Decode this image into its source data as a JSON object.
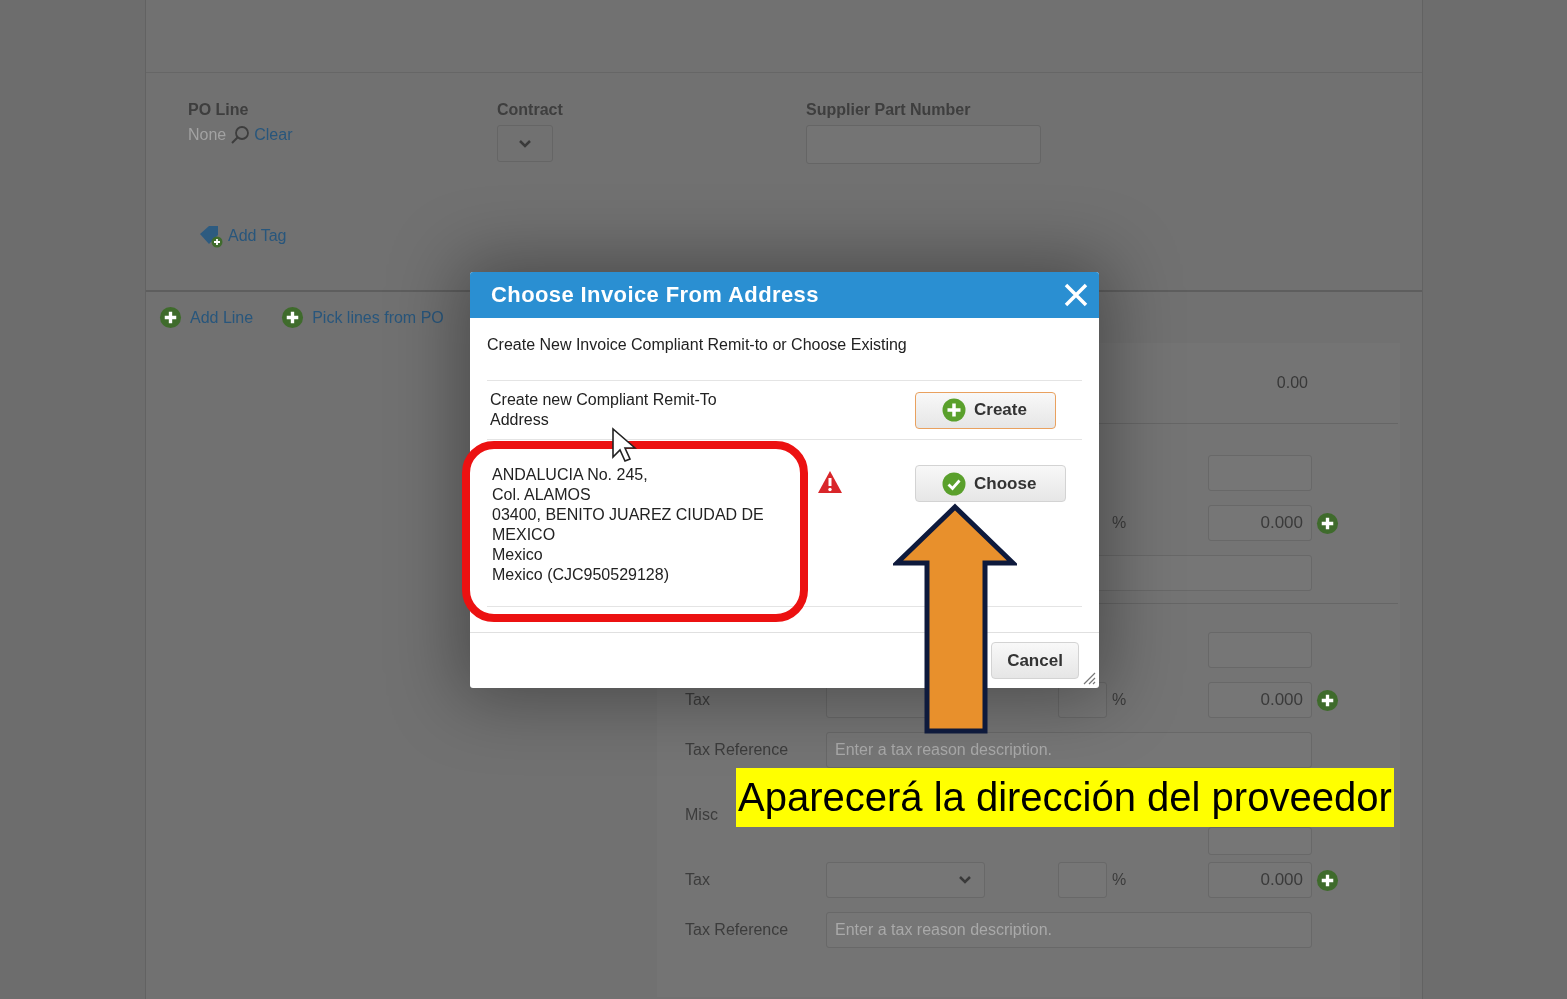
{
  "page": {
    "po_line": {
      "label": "PO Line",
      "value": "None",
      "clear_link": "Clear"
    },
    "contract": {
      "label": "Contract"
    },
    "supplier_part_number": {
      "label": "Supplier Part Number"
    },
    "add_tag": "Add Tag",
    "line_actions": [
      "Add Line",
      "Pick lines from PO"
    ]
  },
  "charges_panel": {
    "total": "0.00",
    "sections": [
      {
        "rows": [
          {
            "kind": "amount"
          },
          {
            "kind": "tax_partial",
            "percent": "%",
            "amount": "0.000"
          },
          {
            "kind": "reference"
          }
        ]
      },
      {
        "rows": [
          {
            "kind": "amount"
          },
          {
            "kind": "tax",
            "label": "Tax",
            "percent": "%",
            "amount": "0.000"
          },
          {
            "kind": "reference",
            "label": "Tax Reference",
            "placeholder": "Enter a tax reason description."
          },
          {
            "kind": "misc",
            "label": "Misc"
          },
          {
            "kind": "tax",
            "label": "Tax",
            "percent": "%",
            "amount": "0.000"
          },
          {
            "kind": "reference",
            "label": "Tax Reference",
            "placeholder": "Enter a tax reason description."
          }
        ]
      }
    ]
  },
  "dialog": {
    "title": "Choose Invoice From Address",
    "intro": "Create New Invoice Compliant Remit-to or Choose Existing",
    "options": [
      {
        "kind": "create",
        "text": "Create new Compliant Remit-To Address",
        "button": "Create"
      },
      {
        "kind": "existing",
        "address_lines": [
          "ANDALUCIA No. 245,",
          "Col. ALAMOS",
          "03400, BENITO JUAREZ CIUDAD DE MEXICO",
          "Mexico",
          "Mexico (CJC950529128)"
        ],
        "warning": true,
        "button": "Choose"
      }
    ],
    "cancel": "Cancel"
  },
  "annotation": {
    "caption": "Aparecerá la dirección del proveedor"
  }
}
